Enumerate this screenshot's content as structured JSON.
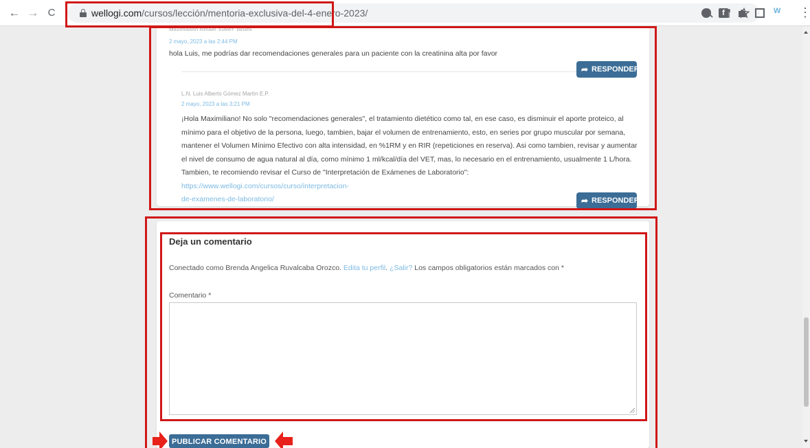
{
  "browser": {
    "back_icon": "←",
    "forward_icon": "→",
    "reload_icon": "C",
    "url_host": "wellogi.com",
    "url_path": "/cursos/lección/mentoria-exclusiva-del-4-enero-2023/",
    "icons": [
      "zoom-icon",
      "share-icon",
      "star-icon",
      "extension-circle-icon",
      "extension-f-icon",
      "puzzle-icon",
      "sidepanel-icon",
      "wellogi-extension-icon",
      "kebab-menu-icon"
    ],
    "ext_f_label": "f",
    "ext_logo_label": "W",
    "kebab": "⋮"
  },
  "comments": {
    "first": {
      "author": "Maximiliano Ismael Juárez Japata",
      "date": "2 mayo, 2023 a las 2:44 PM",
      "text": "hola Luis, me podrías dar recomendaciones generales para un paciente con la creatinina alta por favor",
      "reply_label": "RESPONDER"
    },
    "reply": {
      "author": "L.N. Luis Alberto Gómez Martín E.P.",
      "date": "2 mayo, 2023 a las 3:21 PM",
      "line1": "¡Hola Maximiliano! No solo \"recomendaciones generales\", el tratamiento dietético como tal, en ese caso, es disminuir el aporte proteico, al",
      "line2": "mínimo para el objetivo de la persona, luego, tambien, bajar el volumen de entrenamiento, esto, en series por grupo muscular por semana,",
      "line3": "mantener el Volumen Mínimo Efectivo con alta intensidad, en %1RM y en RIR (repeticiones en reserva). Asi como tambien, revisar y aumentar",
      "line4": "el nivel de consumo de agua natural al día, como mínimo 1 ml/kcal/día del VET, mas, lo necesario en el entrenamiento, usualmente 1 L/hora.",
      "line5": "Tambien, te recomiendo revisar el Curso de \"Interpretación de Exámenes de Laboratorio\": ",
      "link_part1": "https://www.wellogi.com/cursos/curso/interpretacion-",
      "link_part2": "de-examenes-de-laboratorio/",
      "reply_label": "RESPONDER"
    }
  },
  "form": {
    "title": "Deja un comentario",
    "logged_prefix": "Conectado como Brenda Angelica Ruvalcaba Orozco. ",
    "edit_profile": "Edita tu perfil",
    "sep": ". ",
    "logout": "¿Salir?",
    "required_note": " Los campos obligatorios están marcados con *",
    "comment_label": "Comentario *",
    "comment_value": "",
    "submit_label": "PUBLICAR COMENTARIO"
  },
  "annotation_color": "#d01717",
  "arrow_color": "#e8211a",
  "button_color": "#3b6d96",
  "link_color": "#7cbae3"
}
